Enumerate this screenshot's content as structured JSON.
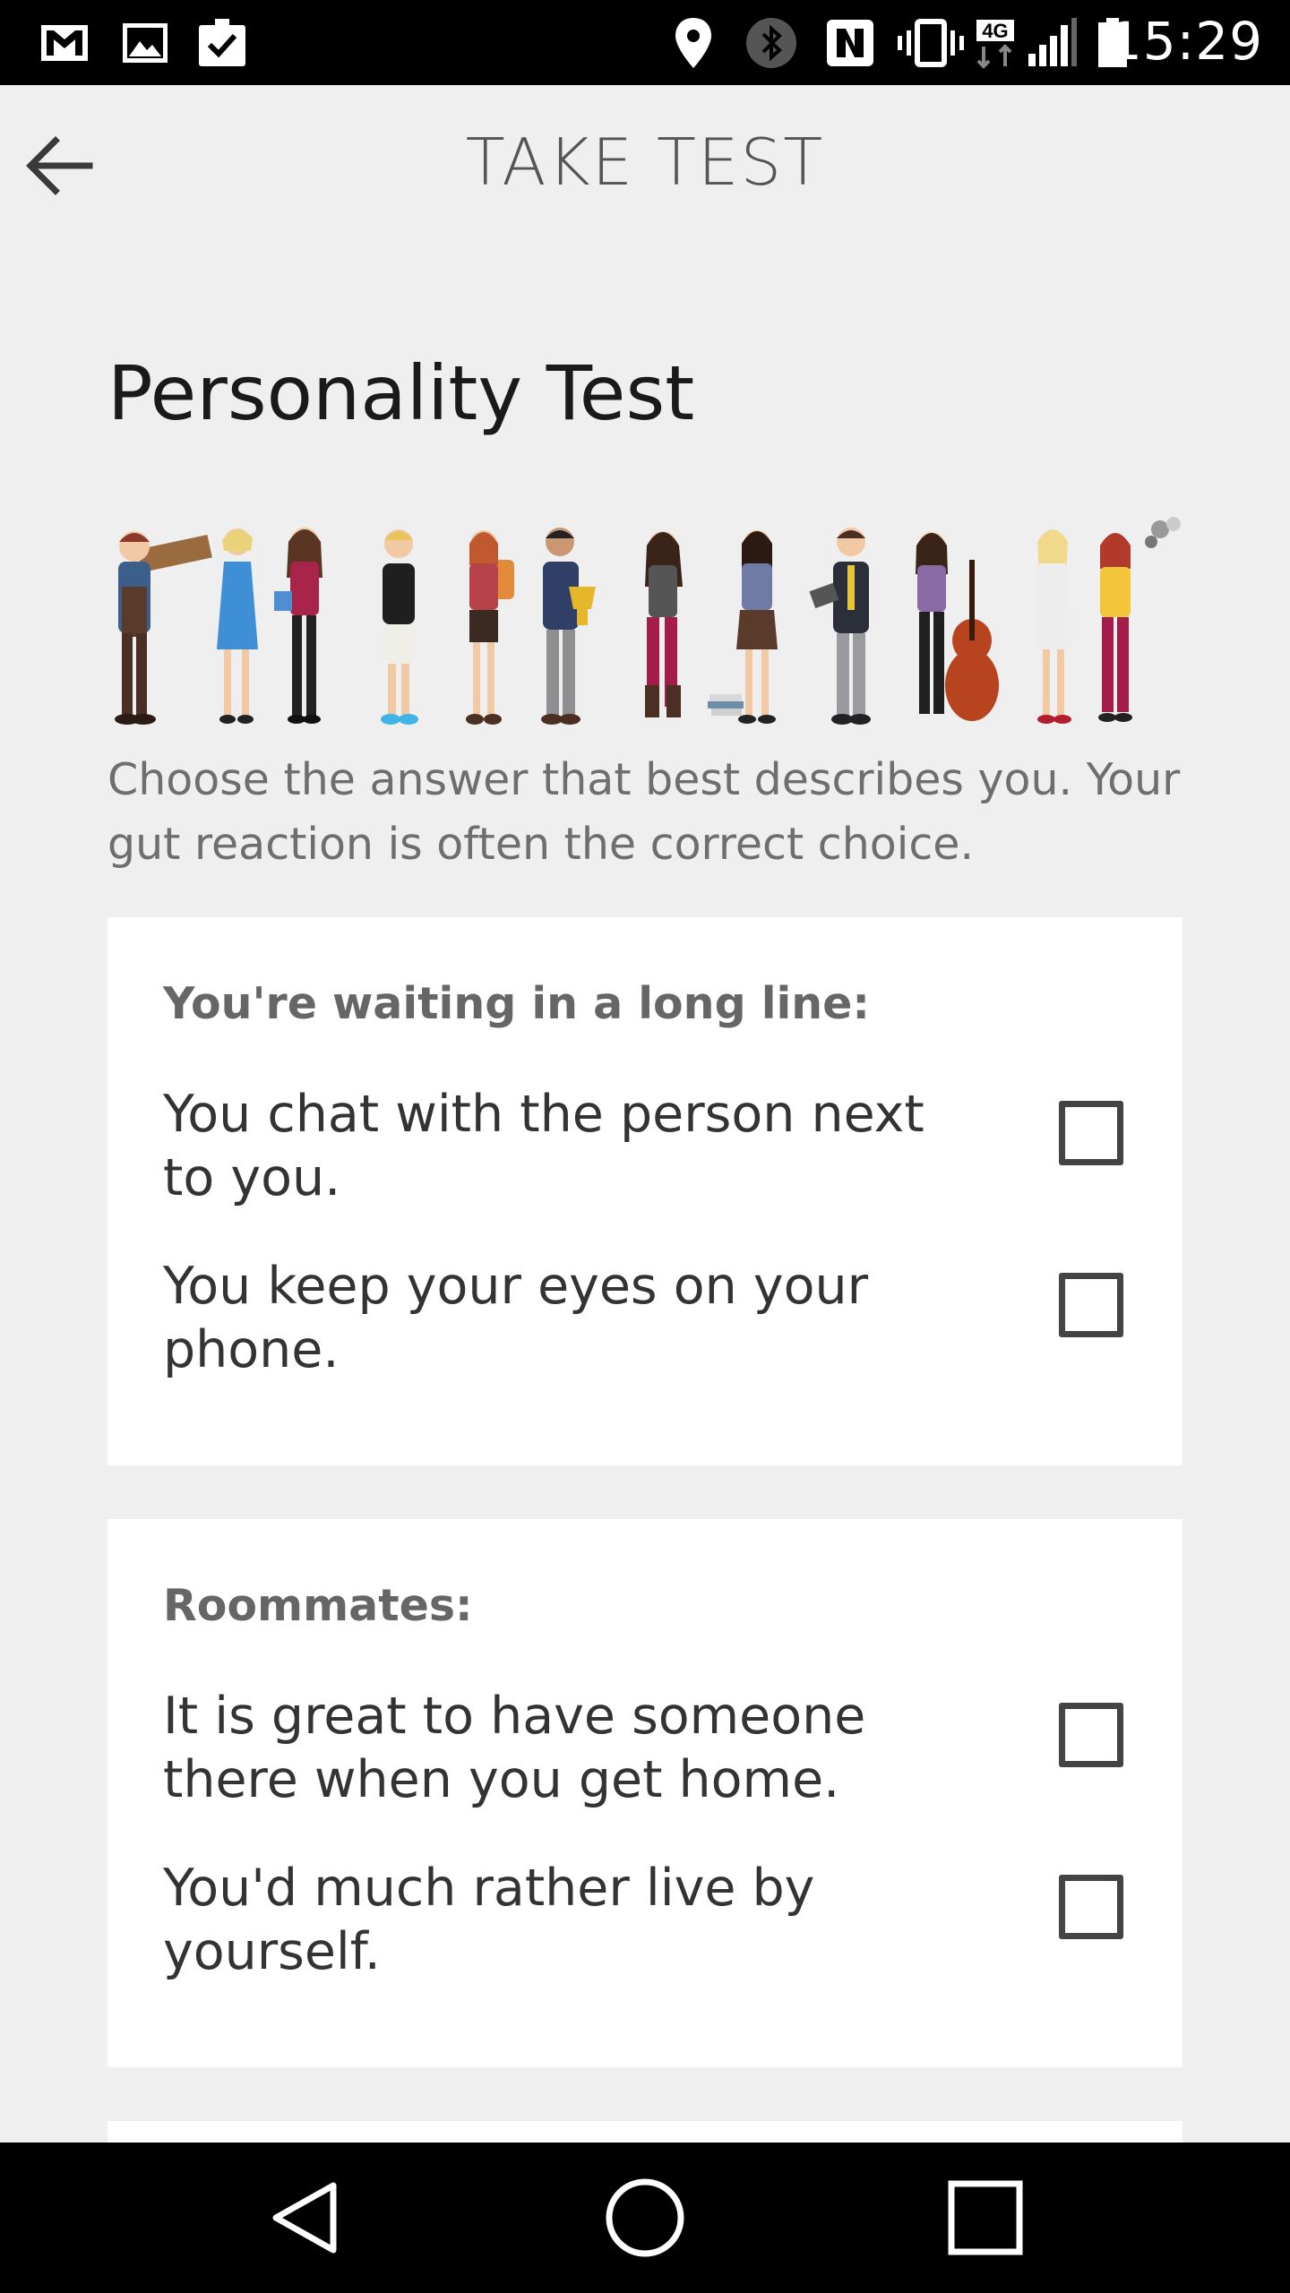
{
  "status_bar": {
    "time": "15:29",
    "network_type": "4G",
    "icons": [
      "gmail-icon",
      "gallery-icon",
      "clipboard-check-icon",
      "location-icon",
      "bluetooth-icon",
      "nfc-icon",
      "vibrate-icon",
      "4g-icon",
      "signal-icon",
      "battery-icon"
    ]
  },
  "app_bar": {
    "title": "TAKE TEST",
    "back_icon": "arrow-back-icon"
  },
  "page": {
    "title": "Personality Test",
    "illustration": "people-illustration",
    "instructions": "Choose the answer that best describes you. Your gut reaction is often the correct choice."
  },
  "questions": [
    {
      "question": "You're waiting in a long line:",
      "options": [
        {
          "text": "You chat with the person next to you.",
          "checked": false
        },
        {
          "text": "You keep your eyes on your phone.",
          "checked": false
        }
      ]
    },
    {
      "question": "Roommates:",
      "options": [
        {
          "text": "It is great to have someone there when you get home.",
          "checked": false
        },
        {
          "text": "You'd much rather live by yourself.",
          "checked": false
        }
      ]
    }
  ],
  "nav_bar": {
    "back_icon": "nav-back-icon",
    "home_icon": "nav-home-icon",
    "recents_icon": "nav-recents-icon"
  },
  "colors": {
    "background": "#efefef",
    "card": "#ffffff",
    "bars": "#000000"
  }
}
